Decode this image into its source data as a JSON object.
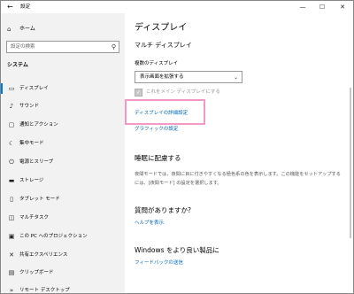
{
  "window": {
    "title": "設定",
    "back_glyph": "←",
    "minimize_glyph": "—",
    "maximize_glyph": "☐",
    "close_glyph": "✕"
  },
  "sidebar": {
    "home_label": "ホーム",
    "search_placeholder": "設定の検索",
    "section": "システム",
    "items": [
      {
        "label": "ディスプレイ",
        "icon": "display-icon",
        "glyph": "▭",
        "active": true
      },
      {
        "label": "サウンド",
        "icon": "sound-icon",
        "glyph": "♪"
      },
      {
        "label": "通知とアクション",
        "icon": "notification-icon",
        "glyph": "▢"
      },
      {
        "label": "集中モード",
        "icon": "focus-moon-icon",
        "glyph": "☾"
      },
      {
        "label": "電源とスリープ",
        "icon": "power-icon",
        "glyph": "⏻"
      },
      {
        "label": "ストレージ",
        "icon": "storage-icon",
        "glyph": "▬"
      },
      {
        "label": "タブレット モード",
        "icon": "tablet-icon",
        "glyph": "▯"
      },
      {
        "label": "マルチタスク",
        "icon": "multitask-icon",
        "glyph": "◫"
      },
      {
        "label": "この PC へのプロジェクション",
        "icon": "projection-icon",
        "glyph": "▣"
      },
      {
        "label": "共有エクスペリエンス",
        "icon": "shared-experience-icon",
        "glyph": "✕"
      },
      {
        "label": "クリップボード",
        "icon": "clipboard-icon",
        "glyph": "▤"
      },
      {
        "label": "リモート デスクトップ",
        "icon": "remote-desktop-icon",
        "glyph": "»"
      }
    ]
  },
  "main": {
    "title": "ディスプレイ",
    "multi_display_heading": "マルチ ディスプレイ",
    "multi_display_label": "複数のディスプレイ",
    "multi_display_value": "表示画面を拡張する",
    "main_display_checkbox_label": "これをメイン ディスプレイにする",
    "advanced_display_link": "ディスプレイの詳細設定",
    "graphics_link": "グラフィックの設定",
    "sleep_heading": "睡眠に配慮する",
    "sleep_text": "夜間モードでは、夜間に目に付きやすくなる極色系の色を表示します。この機能をセットアップするには、[夜間モード] の設定を選択します。",
    "question_heading": "質問がありますか?",
    "help_link": "ヘルプを表示",
    "improve_heading": "Windows をより良い製品に",
    "feedback_link": "フィードバックの送信"
  },
  "colors": {
    "accent": "#0078d4",
    "link": "#0067b8",
    "highlight_box": "#f29ac5",
    "sidebar_bg": "#f2f2f2"
  }
}
